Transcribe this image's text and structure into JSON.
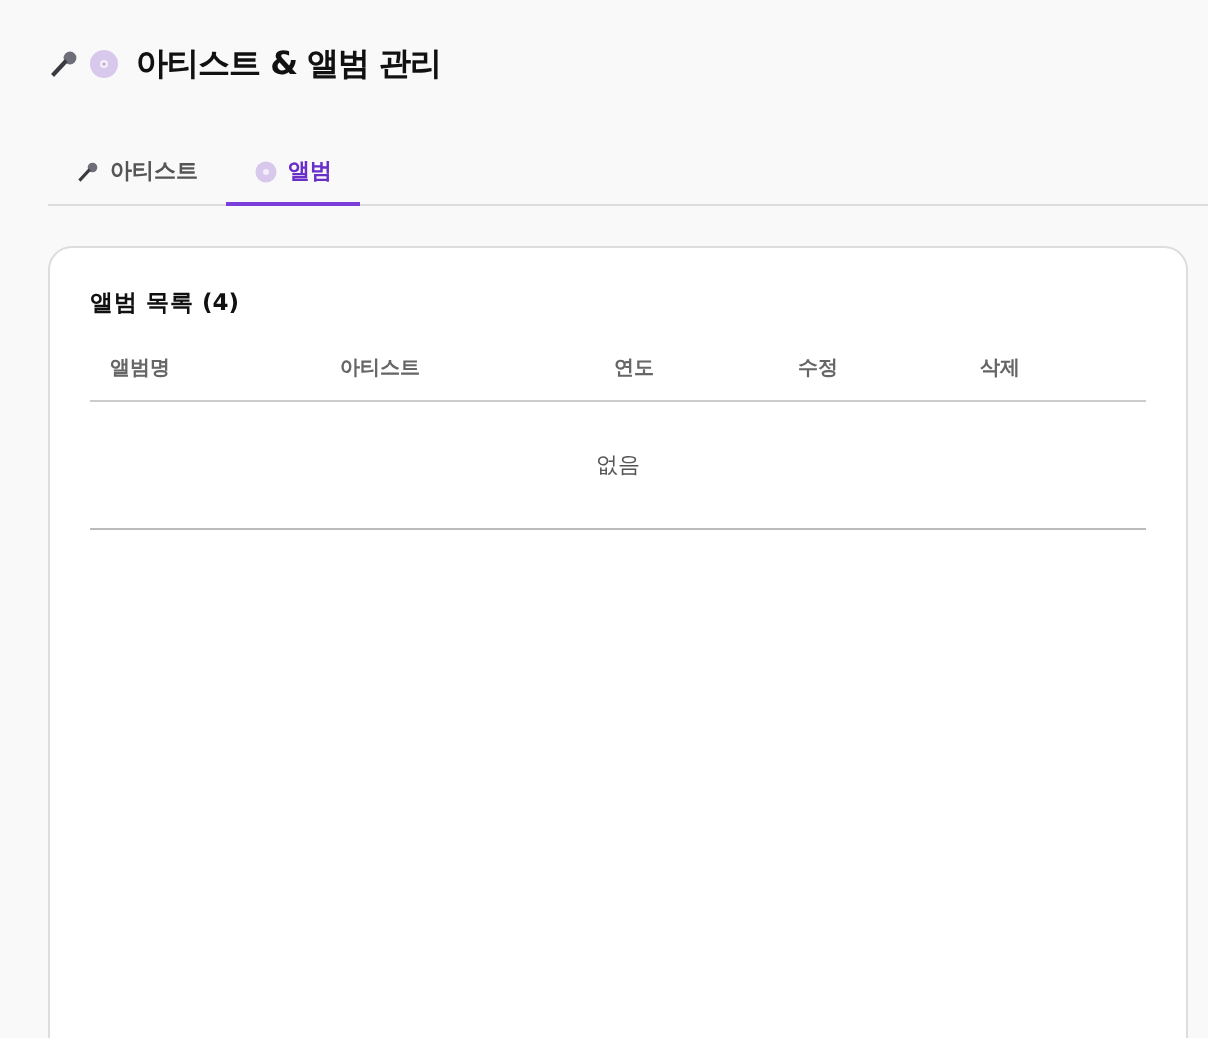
{
  "page": {
    "title": "아티스트 & 앨범 관리"
  },
  "tabs": [
    {
      "label": "아티스트",
      "kind": "artist",
      "selected": false
    },
    {
      "label": "앨범",
      "kind": "album",
      "selected": true
    }
  ],
  "album_list": {
    "title": "앨범 목록 (4)",
    "columns": [
      "앨범명",
      "아티스트",
      "연도",
      "수정",
      "삭제"
    ],
    "empty_text": "없음"
  }
}
